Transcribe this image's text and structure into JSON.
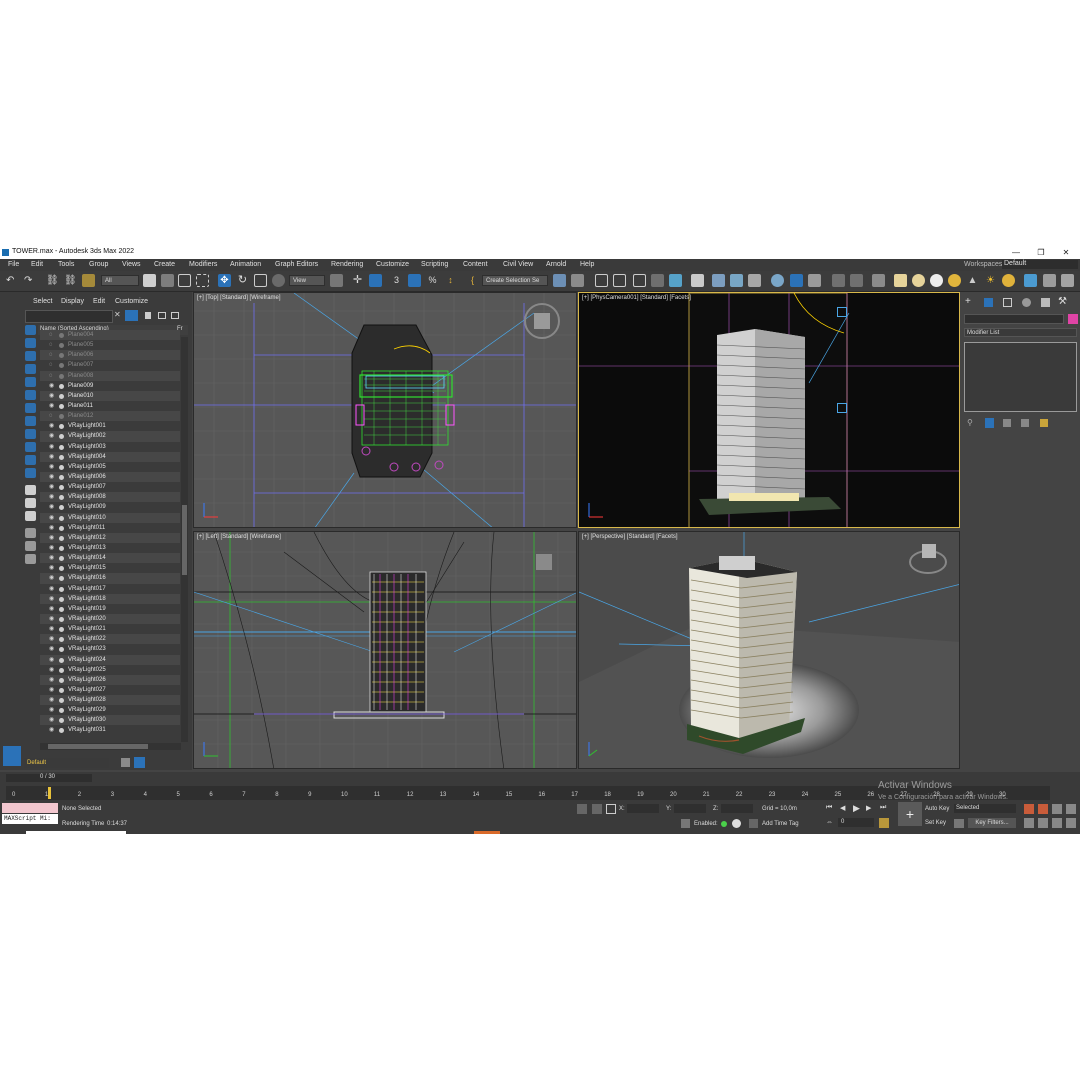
{
  "window": {
    "title": "TOWER.max - Autodesk 3ds Max 2022",
    "controls": [
      "—",
      "❐",
      "✕"
    ]
  },
  "menu": [
    "File",
    "Edit",
    "Tools",
    "Group",
    "Views",
    "Create",
    "Modifiers",
    "Animation",
    "Graph Editors",
    "Rendering",
    "Customize",
    "Scripting",
    "Content",
    "Civil View",
    "Arnold",
    "Help"
  ],
  "workspace": {
    "label": "Workspaces:",
    "value": "Default"
  },
  "toolbar": {
    "filter_all": "All",
    "ref_coord": "View",
    "selection_set": "Create Selection Se"
  },
  "scene_explorer": {
    "tabs": [
      "Select",
      "Display",
      "Edit",
      "Customize"
    ],
    "column_header": "Name (Sorted Ascending)",
    "column_header_right": "Fr",
    "items": [
      {
        "name": "Plane004",
        "hidden": true
      },
      {
        "name": "Plane005",
        "hidden": true
      },
      {
        "name": "Plane006",
        "hidden": true
      },
      {
        "name": "Plane007",
        "hidden": true
      },
      {
        "name": "Plane008",
        "hidden": true
      },
      {
        "name": "Plane009",
        "hidden": false
      },
      {
        "name": "Plane010",
        "hidden": false
      },
      {
        "name": "Plane011",
        "hidden": false
      },
      {
        "name": "Plane012",
        "hidden": true
      },
      {
        "name": "VRayLight001",
        "hidden": false
      },
      {
        "name": "VRayLight002",
        "hidden": false
      },
      {
        "name": "VRayLight003",
        "hidden": false
      },
      {
        "name": "VRayLight004",
        "hidden": false
      },
      {
        "name": "VRayLight005",
        "hidden": false
      },
      {
        "name": "VRayLight006",
        "hidden": false
      },
      {
        "name": "VRayLight007",
        "hidden": false
      },
      {
        "name": "VRayLight008",
        "hidden": false
      },
      {
        "name": "VRayLight009",
        "hidden": false
      },
      {
        "name": "VRayLight010",
        "hidden": false
      },
      {
        "name": "VRayLight011",
        "hidden": false
      },
      {
        "name": "VRayLight012",
        "hidden": false
      },
      {
        "name": "VRayLight013",
        "hidden": false
      },
      {
        "name": "VRayLight014",
        "hidden": false
      },
      {
        "name": "VRayLight015",
        "hidden": false
      },
      {
        "name": "VRayLight016",
        "hidden": false
      },
      {
        "name": "VRayLight017",
        "hidden": false
      },
      {
        "name": "VRayLight018",
        "hidden": false
      },
      {
        "name": "VRayLight019",
        "hidden": false
      },
      {
        "name": "VRayLight020",
        "hidden": false
      },
      {
        "name": "VRayLight021",
        "hidden": false
      },
      {
        "name": "VRayLight022",
        "hidden": false
      },
      {
        "name": "VRayLight023",
        "hidden": false
      },
      {
        "name": "VRayLight024",
        "hidden": false
      },
      {
        "name": "VRayLight025",
        "hidden": false
      },
      {
        "name": "VRayLight026",
        "hidden": false
      },
      {
        "name": "VRayLight027",
        "hidden": false
      },
      {
        "name": "VRayLight028",
        "hidden": false
      },
      {
        "name": "VRayLight029",
        "hidden": false
      },
      {
        "name": "VRayLight030",
        "hidden": false
      },
      {
        "name": "VRayLight031",
        "hidden": false
      }
    ],
    "layer": "Default"
  },
  "viewports": {
    "top": "[+] [Top] [Standard] [Wireframe]",
    "camera": "[+] [PhysCamera001] [Standard] [Facets]",
    "left": "[+] [Left] [Standard] [Wireframe]",
    "perspective": "[+] [Perspective] [Standard] [Facets]"
  },
  "command_panel": {
    "modifier_list": "Modifier List"
  },
  "timeline": {
    "frame": "0 / 30",
    "ticks": [
      "0",
      "1",
      "2",
      "3",
      "4",
      "5",
      "6",
      "7",
      "8",
      "9",
      "10",
      "11",
      "12",
      "13",
      "14",
      "15",
      "16",
      "17",
      "18",
      "19",
      "20",
      "21",
      "22",
      "23",
      "24",
      "25",
      "26",
      "27",
      "28",
      "29",
      "30"
    ]
  },
  "status": {
    "selection": "None Selected",
    "render_time_label": "Rendering Time",
    "render_time": "0:14:37",
    "maxscript": "MAXScript Mi:",
    "x_label": "X:",
    "y_label": "Y:",
    "z_label": "Z:",
    "grid": "Grid = 10,0m",
    "enabled": "Enabled:",
    "add_time_tag": "Add Time Tag",
    "auto_key": "Auto Key",
    "selected": "Selected",
    "set_key": "Set Key",
    "key_filters": "Key Filters...",
    "frame_field": "0"
  },
  "activation": {
    "line1": "Activar Windows",
    "line2": "Ve a Configuración para activar Windows."
  }
}
